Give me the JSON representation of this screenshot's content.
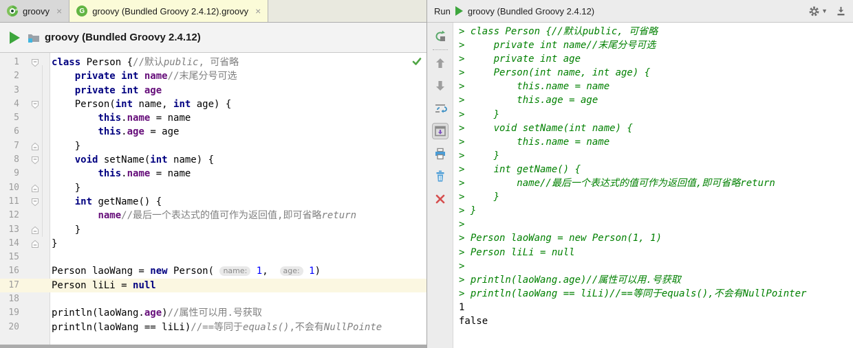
{
  "colors": {
    "keyword": "#000080",
    "field": "#660E7A",
    "number": "#0000FF",
    "comment": "#808080",
    "console_input_green": "#008000",
    "caret_line": "#FBF7E1",
    "run_green": "#3DA63D",
    "active_tab": "#FBFBD8"
  },
  "left_panel": {
    "tabs": [
      {
        "label": "groovy",
        "close": "×",
        "icon": "groovy-logo-icon",
        "active": false
      },
      {
        "label": "groovy (Bundled Groovy 2.4.12).groovy",
        "close": "×",
        "icon": "groovy-file-icon",
        "active": true
      }
    ],
    "run_bar": {
      "config_name": "groovy (Bundled Groovy 2.4.12)"
    },
    "editor": {
      "status_icon": "inspections-ok-checkmark",
      "lines": [
        {
          "n": 1,
          "fold": "open",
          "hl": false,
          "seg": [
            {
              "t": "class",
              "c": "k"
            },
            {
              "t": " Person {",
              "c": "p"
            },
            {
              "t": "//默认",
              "c": "c"
            },
            {
              "t": "public",
              "c": "ci"
            },
            {
              "t": ", 可省略",
              "c": "c"
            }
          ]
        },
        {
          "n": 2,
          "fold": "none",
          "hl": false,
          "seg": [
            {
              "t": "    ",
              "c": "p"
            },
            {
              "t": "private int ",
              "c": "k"
            },
            {
              "t": "name",
              "c": "f"
            },
            {
              "t": "//末尾分号可选",
              "c": "c"
            }
          ]
        },
        {
          "n": 3,
          "fold": "none",
          "hl": false,
          "seg": [
            {
              "t": "    ",
              "c": "p"
            },
            {
              "t": "private int ",
              "c": "k"
            },
            {
              "t": "age",
              "c": "f"
            }
          ]
        },
        {
          "n": 4,
          "fold": "open",
          "hl": false,
          "seg": [
            {
              "t": "    Person(",
              "c": "p"
            },
            {
              "t": "int",
              "c": "k"
            },
            {
              "t": " name, ",
              "c": "p"
            },
            {
              "t": "int",
              "c": "k"
            },
            {
              "t": " age) {",
              "c": "p"
            }
          ]
        },
        {
          "n": 5,
          "fold": "none",
          "hl": false,
          "seg": [
            {
              "t": "        ",
              "c": "p"
            },
            {
              "t": "this",
              "c": "k"
            },
            {
              "t": ".",
              "c": "p"
            },
            {
              "t": "name",
              "c": "f"
            },
            {
              "t": " = name",
              "c": "p"
            }
          ]
        },
        {
          "n": 6,
          "fold": "none",
          "hl": false,
          "seg": [
            {
              "t": "        ",
              "c": "p"
            },
            {
              "t": "this",
              "c": "k"
            },
            {
              "t": ".",
              "c": "p"
            },
            {
              "t": "age",
              "c": "f"
            },
            {
              "t": " = age",
              "c": "p"
            }
          ]
        },
        {
          "n": 7,
          "fold": "end",
          "hl": false,
          "seg": [
            {
              "t": "    }",
              "c": "p"
            }
          ]
        },
        {
          "n": 8,
          "fold": "open",
          "hl": false,
          "seg": [
            {
              "t": "    ",
              "c": "p"
            },
            {
              "t": "void",
              "c": "k"
            },
            {
              "t": " setName(",
              "c": "p"
            },
            {
              "t": "int",
              "c": "k"
            },
            {
              "t": " name) {",
              "c": "p"
            }
          ]
        },
        {
          "n": 9,
          "fold": "none",
          "hl": false,
          "seg": [
            {
              "t": "        ",
              "c": "p"
            },
            {
              "t": "this",
              "c": "k"
            },
            {
              "t": ".",
              "c": "p"
            },
            {
              "t": "name",
              "c": "f"
            },
            {
              "t": " = name",
              "c": "p"
            }
          ]
        },
        {
          "n": 10,
          "fold": "end",
          "hl": false,
          "seg": [
            {
              "t": "    }",
              "c": "p"
            }
          ]
        },
        {
          "n": 11,
          "fold": "open",
          "hl": false,
          "seg": [
            {
              "t": "    ",
              "c": "p"
            },
            {
              "t": "int",
              "c": "k"
            },
            {
              "t": " getName() {",
              "c": "p"
            }
          ]
        },
        {
          "n": 12,
          "fold": "none",
          "hl": false,
          "seg": [
            {
              "t": "        ",
              "c": "p"
            },
            {
              "t": "name",
              "c": "f"
            },
            {
              "t": "//最后一个表达式的值可作为返回值,即可省略",
              "c": "c"
            },
            {
              "t": "return",
              "c": "ci"
            }
          ]
        },
        {
          "n": 13,
          "fold": "end",
          "hl": false,
          "seg": [
            {
              "t": "    }",
              "c": "p"
            }
          ]
        },
        {
          "n": 14,
          "fold": "end",
          "hl": false,
          "seg": [
            {
              "t": "}",
              "c": "p"
            }
          ]
        },
        {
          "n": 15,
          "fold": "none",
          "hl": false,
          "seg": []
        },
        {
          "n": 16,
          "fold": "none",
          "hl": false,
          "seg": [
            {
              "t": "Person laoWang = ",
              "c": "p"
            },
            {
              "t": "new",
              "c": "k"
            },
            {
              "t": " Person( ",
              "c": "p"
            },
            {
              "t": "name:",
              "c": "h"
            },
            {
              "t": " ",
              "c": "p"
            },
            {
              "t": "1",
              "c": "n"
            },
            {
              "t": ",  ",
              "c": "p"
            },
            {
              "t": "age:",
              "c": "h"
            },
            {
              "t": " ",
              "c": "p"
            },
            {
              "t": "1",
              "c": "n"
            },
            {
              "t": ")",
              "c": "p"
            }
          ]
        },
        {
          "n": 17,
          "fold": "none",
          "hl": true,
          "seg": [
            {
              "t": "Person liLi = ",
              "c": "p"
            },
            {
              "t": "null",
              "c": "k"
            }
          ]
        },
        {
          "n": 18,
          "fold": "none",
          "hl": false,
          "seg": []
        },
        {
          "n": 19,
          "fold": "none",
          "hl": false,
          "seg": [
            {
              "t": "println(laoWang.",
              "c": "p"
            },
            {
              "t": "age",
              "c": "f"
            },
            {
              "t": ")",
              "c": "p"
            },
            {
              "t": "//属性可以用.号获取",
              "c": "c"
            }
          ]
        },
        {
          "n": 20,
          "fold": "none",
          "hl": false,
          "seg": [
            {
              "t": "println(laoWang == liLi)",
              "c": "p"
            },
            {
              "t": "//==等同于",
              "c": "c"
            },
            {
              "t": "equals()",
              "c": "ci"
            },
            {
              "t": ",不会有",
              "c": "c"
            },
            {
              "t": "NullPointe",
              "c": "ci"
            }
          ]
        }
      ]
    }
  },
  "right_panel": {
    "header": {
      "run_label": "Run",
      "title": "groovy (Bundled Groovy 2.4.12)",
      "icons": [
        "gear-icon",
        "hide-panel-icon"
      ]
    },
    "toolbar": [
      {
        "name": "rerun-icon",
        "pressed": false,
        "sep_after": true
      },
      {
        "name": "up-arrow-icon",
        "pressed": false,
        "sep_after": false
      },
      {
        "name": "down-arrow-icon",
        "pressed": false,
        "sep_after": false
      },
      {
        "name": "soft-wrap-icon",
        "pressed": false,
        "sep_after": false
      },
      {
        "name": "scroll-to-end-icon",
        "pressed": true,
        "sep_after": false
      },
      {
        "name": "print-icon",
        "pressed": false,
        "sep_after": false
      },
      {
        "name": "clear-all-icon",
        "pressed": false,
        "sep_after": false
      },
      {
        "name": "close-icon",
        "pressed": false,
        "sep_after": false
      }
    ],
    "console": {
      "lines": [
        {
          "type": "input",
          "text": "> class Person {//默认public, 可省略"
        },
        {
          "type": "input",
          "text": ">     private int name//末尾分号可选"
        },
        {
          "type": "input",
          "text": ">     private int age"
        },
        {
          "type": "input",
          "text": ">     Person(int name, int age) {"
        },
        {
          "type": "input",
          "text": ">         this.name = name"
        },
        {
          "type": "input",
          "text": ">         this.age = age"
        },
        {
          "type": "input",
          "text": ">     }"
        },
        {
          "type": "input",
          "text": ">     void setName(int name) {"
        },
        {
          "type": "input",
          "text": ">         this.name = name"
        },
        {
          "type": "input",
          "text": ">     }"
        },
        {
          "type": "input",
          "text": ">     int getName() {"
        },
        {
          "type": "input",
          "text": ">         name//最后一个表达式的值可作为返回值,即可省略return"
        },
        {
          "type": "input",
          "text": ">     }"
        },
        {
          "type": "input",
          "text": "> }"
        },
        {
          "type": "input",
          "text": ">"
        },
        {
          "type": "input",
          "text": "> Person laoWang = new Person(1, 1)"
        },
        {
          "type": "input",
          "text": "> Person liLi = null"
        },
        {
          "type": "input",
          "text": ">"
        },
        {
          "type": "input",
          "text": "> println(laoWang.age)//属性可以用.号获取"
        },
        {
          "type": "input",
          "text": "> println(laoWang == liLi)//==等同于equals(),不会有NullPointer"
        },
        {
          "type": "output",
          "text": "1"
        },
        {
          "type": "output",
          "text": "false"
        }
      ]
    }
  }
}
